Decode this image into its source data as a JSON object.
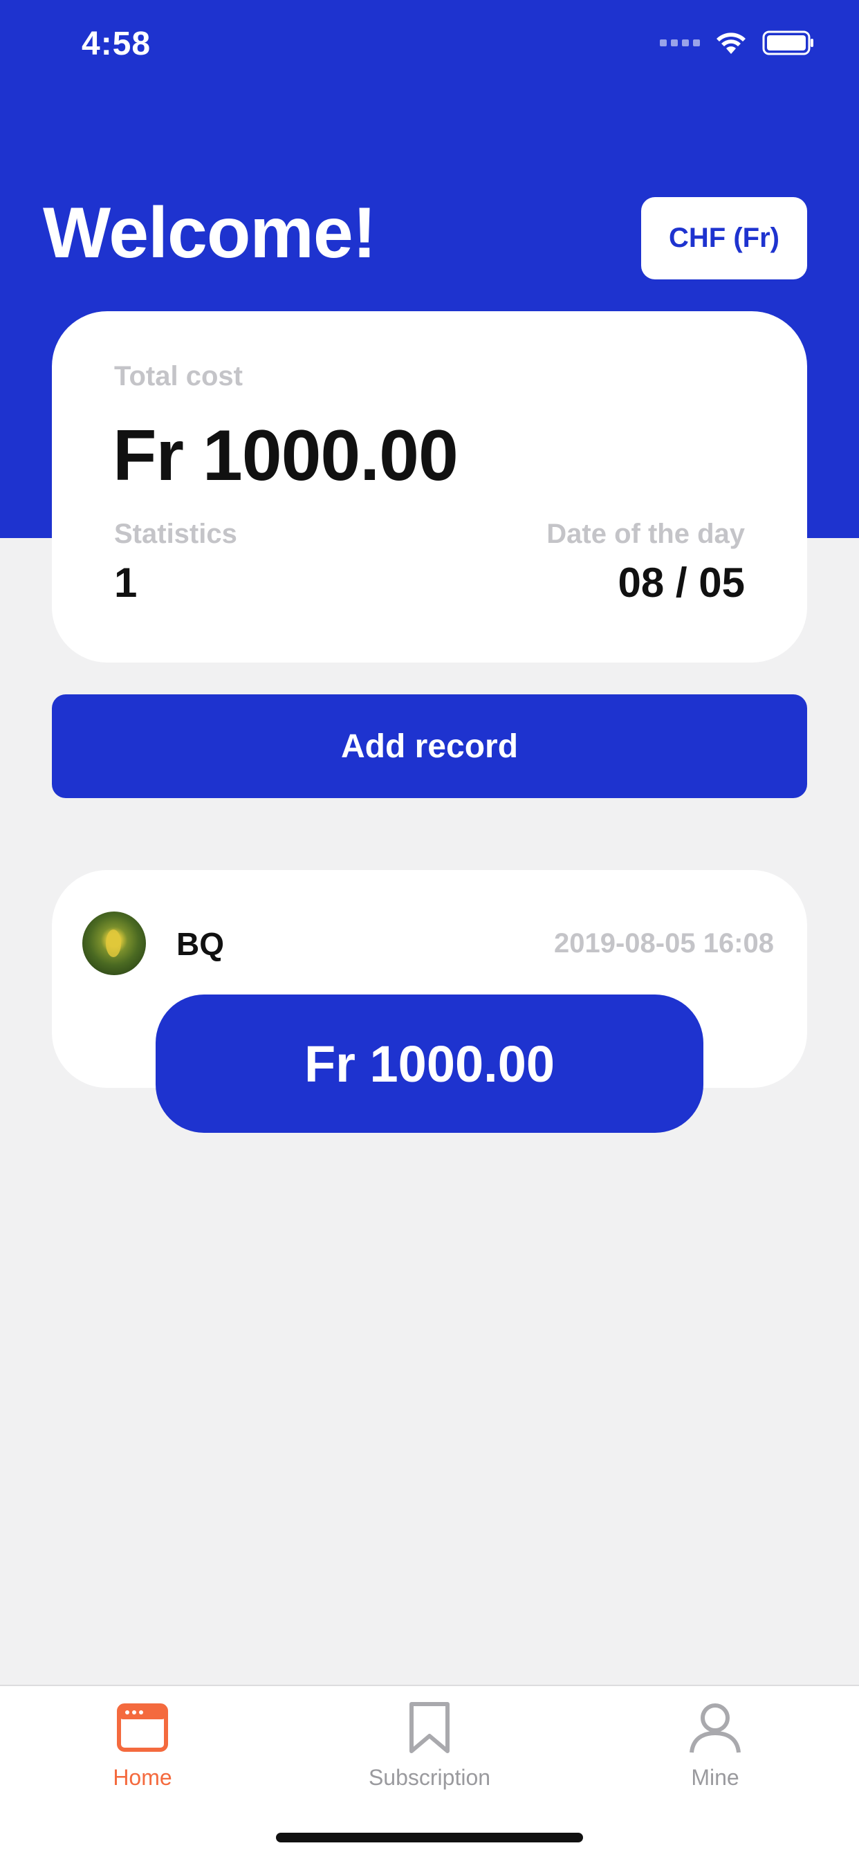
{
  "status_bar": {
    "time": "4:58"
  },
  "header": {
    "title": "Welcome!",
    "currency_button": "CHF (Fr)"
  },
  "summary": {
    "total_label": "Total cost",
    "total_value": "Fr 1000.00",
    "statistics_label": "Statistics",
    "statistics_value": "1",
    "date_label": "Date of the day",
    "date_value": "08 / 05"
  },
  "actions": {
    "add_record": "Add record"
  },
  "records": [
    {
      "name": "BQ",
      "time": "2019-08-05 16:08",
      "amount": "Fr 1000.00"
    }
  ],
  "tab_bar": {
    "items": [
      {
        "label": "Home",
        "icon": "home-calendar-icon",
        "active": true
      },
      {
        "label": "Subscription",
        "icon": "bookmark-icon",
        "active": false
      },
      {
        "label": "Mine",
        "icon": "person-icon",
        "active": false
      }
    ]
  },
  "colors": {
    "brand": "#1e33cf",
    "active_tab": "#f46a3e",
    "inactive_tab": "#9a9a9e",
    "background": "#f1f1f2"
  }
}
